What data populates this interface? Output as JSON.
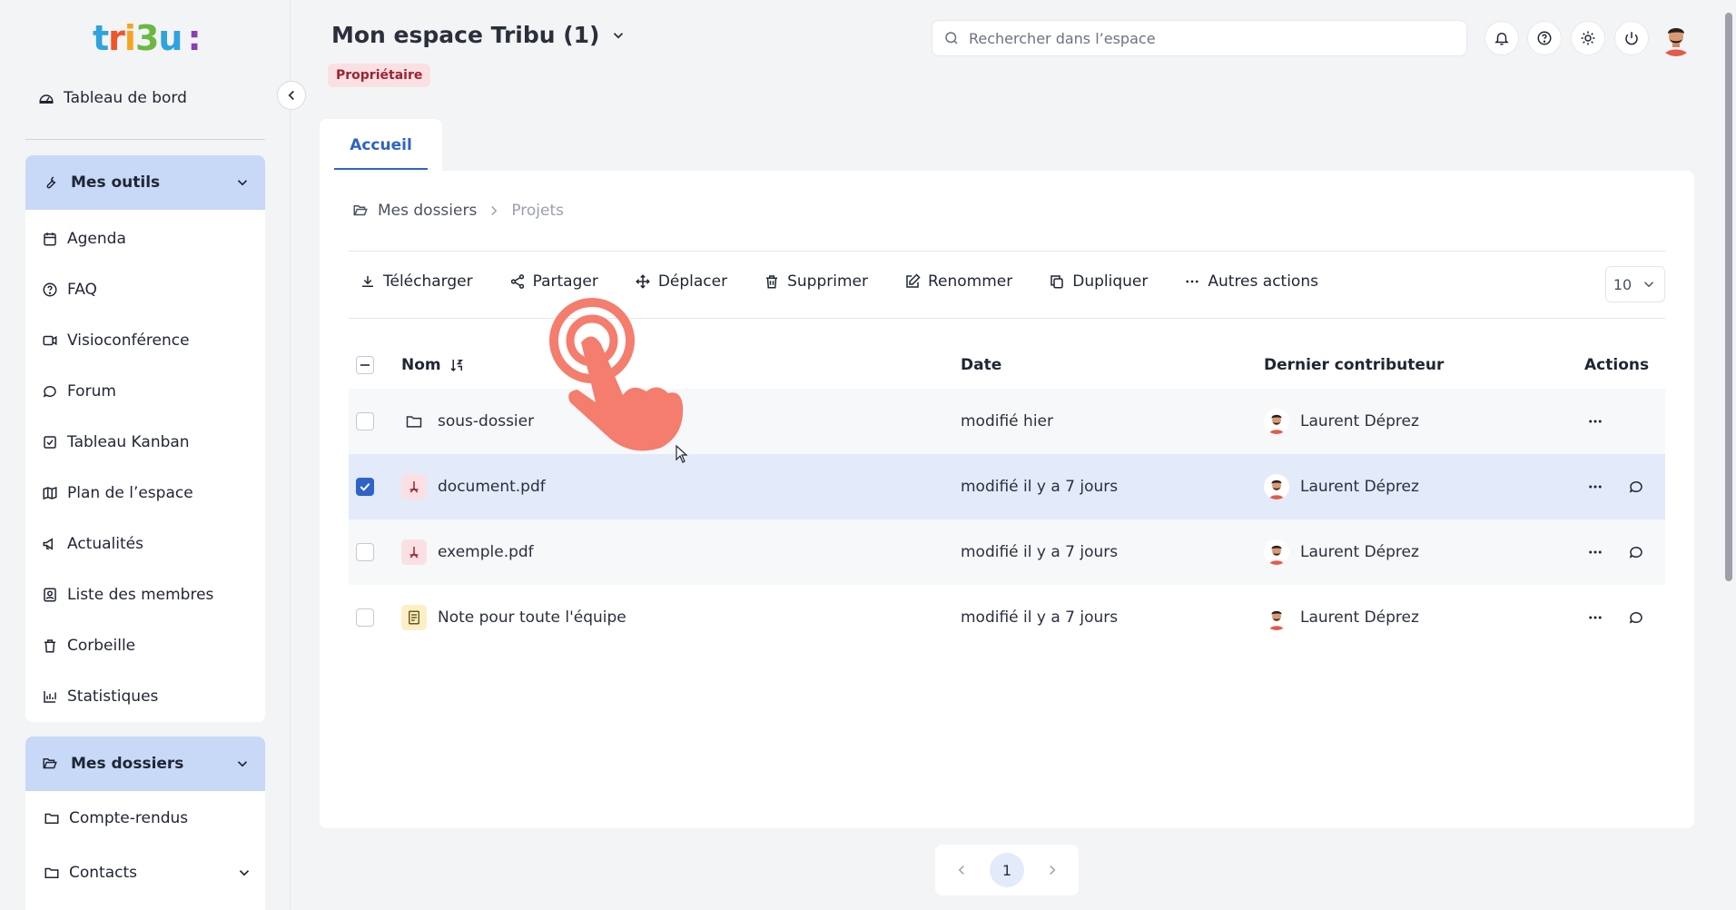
{
  "app": {
    "logo_letters": [
      "t",
      "r",
      "i",
      "3",
      "u",
      ":"
    ],
    "space_title": "Mon espace Tribu (1)",
    "role_badge": "Propriétaire",
    "search_placeholder": "Rechercher dans l’espace"
  },
  "sidebar": {
    "dashboard_label": "Tableau de bord",
    "tools_header": "Mes outils",
    "tools": [
      {
        "label": "Agenda",
        "icon": "calendar-icon"
      },
      {
        "label": "FAQ",
        "icon": "help-circle-icon"
      },
      {
        "label": "Visioconférence",
        "icon": "video-icon"
      },
      {
        "label": "Forum",
        "icon": "chat-icon"
      },
      {
        "label": "Tableau Kanban",
        "icon": "kanban-icon"
      },
      {
        "label": "Plan de l’espace",
        "icon": "map-icon"
      },
      {
        "label": "Actualités",
        "icon": "megaphone-icon"
      },
      {
        "label": "Liste des membres",
        "icon": "members-icon"
      },
      {
        "label": "Corbeille",
        "icon": "trash-icon"
      },
      {
        "label": "Statistiques",
        "icon": "chart-icon"
      }
    ],
    "folders_header": "Mes dossiers",
    "folders": [
      {
        "label": "Compte-rendus"
      },
      {
        "label": "Contacts"
      }
    ]
  },
  "tabs": [
    {
      "label": "Accueil",
      "active": true
    }
  ],
  "breadcrumb": {
    "root": "Mes dossiers",
    "current": "Projets"
  },
  "toolbar": {
    "download": "Télécharger",
    "share": "Partager",
    "move": "Déplacer",
    "delete": "Supprimer",
    "rename": "Renommer",
    "duplicate": "Dupliquer",
    "more": "Autres actions",
    "per_page": "10"
  },
  "table": {
    "columns": {
      "name": "Nom",
      "date": "Date",
      "contributor": "Dernier contributeur",
      "actions": "Actions"
    },
    "rows": [
      {
        "name": "sous-dossier",
        "type": "folder",
        "date": "modifié hier",
        "contributor": "Laurent Déprez",
        "checked": false,
        "comment": false
      },
      {
        "name": "document.pdf",
        "type": "pdf",
        "date": "modifié il y a 7 jours",
        "contributor": "Laurent Déprez",
        "checked": true,
        "comment": true
      },
      {
        "name": "exemple.pdf",
        "type": "pdf",
        "date": "modifié il y a 7 jours",
        "contributor": "Laurent Déprez",
        "checked": false,
        "comment": true
      },
      {
        "name": "Note pour toute l'équipe",
        "type": "note",
        "date": "modifié il y a 7 jours",
        "contributor": "Laurent Déprez",
        "checked": false,
        "comment": true
      }
    ]
  },
  "pagination": {
    "current": "1"
  },
  "colors": {
    "accent": "#2f63c7",
    "sidebar_header": "#c7d9f7",
    "badge_bg": "#fbe0e3",
    "hand": "#f47d6e"
  }
}
